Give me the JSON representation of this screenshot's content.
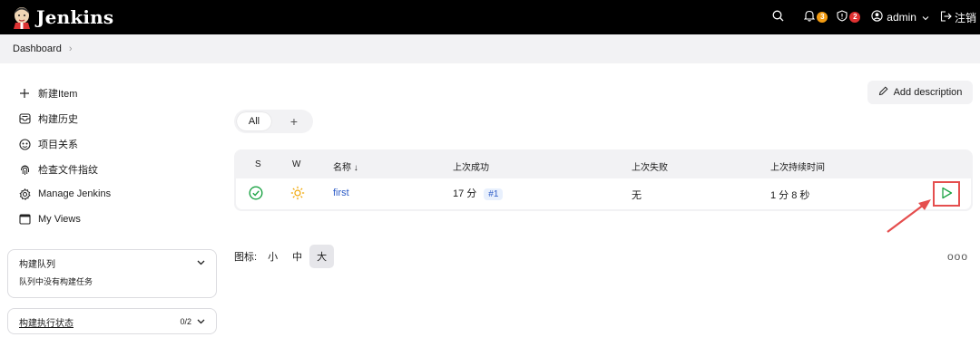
{
  "header": {
    "brand": "Jenkins",
    "notifications": {
      "icon": "bell-icon",
      "count": "3",
      "color": "#f39c12"
    },
    "security": {
      "icon": "shield-icon",
      "count": "2",
      "color": "#e03131"
    },
    "user": "admin",
    "logout": "注销"
  },
  "breadcrumb": {
    "item": "Dashboard"
  },
  "sidebar": {
    "tasks": [
      {
        "label": "新建Item",
        "icon": "plus-icon"
      },
      {
        "label": "构建历史",
        "icon": "inbox-icon"
      },
      {
        "label": "项目关系",
        "icon": "relationship-icon"
      },
      {
        "label": "检查文件指纹",
        "icon": "fingerprint-icon"
      },
      {
        "label": "Manage Jenkins",
        "icon": "gear-icon"
      },
      {
        "label": "My Views",
        "icon": "window-icon"
      }
    ],
    "queue": {
      "title": "构建队列",
      "empty": "队列中没有构建任务"
    },
    "executors": {
      "title": "构建执行状态",
      "count": "0/2"
    }
  },
  "main": {
    "add_description": "Add description",
    "tabs": {
      "all": "All",
      "add": "+"
    },
    "table": {
      "headers": {
        "s": "S",
        "w": "W",
        "name": "名称 ↓",
        "last_success": "上次成功",
        "last_failure": "上次失败",
        "last_duration": "上次持续时间"
      },
      "rows": [
        {
          "name": "first",
          "last_success": "17 分",
          "build": "#1",
          "last_failure": "无",
          "last_duration": "1 分 8 秒"
        }
      ]
    },
    "icon_size": {
      "label": "图标:",
      "small": "小",
      "medium": "中",
      "large": "大"
    },
    "more": "ooo"
  },
  "colors": {
    "success": "#1ea446",
    "weather": "#f0a500",
    "link": "#2c5bc7",
    "annotation": "#e54e4e"
  }
}
